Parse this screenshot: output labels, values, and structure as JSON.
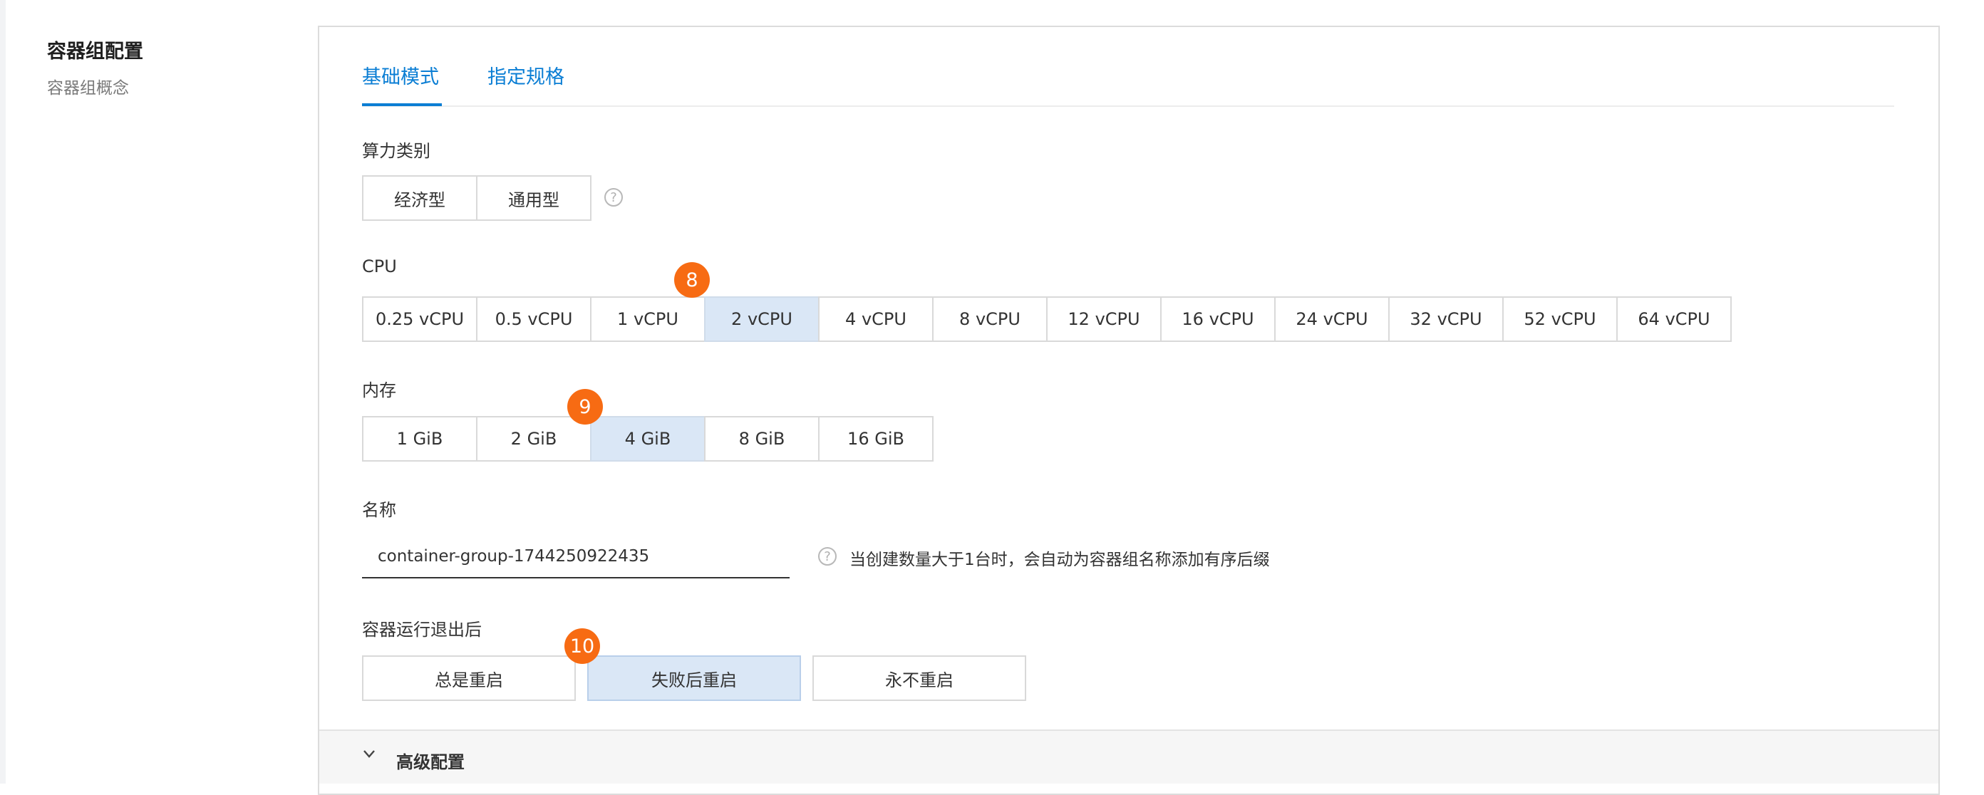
{
  "section": {
    "title": "容器组配置",
    "subtitle": "容器组概念"
  },
  "tabs": [
    {
      "label": "基础模式",
      "active": true
    },
    {
      "label": "指定规格",
      "active": false
    }
  ],
  "compute_type": {
    "label": "算力类别",
    "options": [
      "经济型",
      "通用型"
    ],
    "help_icon": "question-circle-icon"
  },
  "cpu": {
    "label": "CPU",
    "options": [
      "0.25 vCPU",
      "0.5 vCPU",
      "1 vCPU",
      "2 vCPU",
      "4 vCPU",
      "8 vCPU",
      "12 vCPU",
      "16 vCPU",
      "24 vCPU",
      "32 vCPU",
      "52 vCPU",
      "64 vCPU"
    ],
    "selected": "2 vCPU",
    "badge": "8"
  },
  "memory": {
    "label": "内存",
    "options": [
      "1 GiB",
      "2 GiB",
      "4 GiB",
      "8 GiB",
      "16 GiB"
    ],
    "selected": "4 GiB",
    "badge": "9"
  },
  "name": {
    "label": "名称",
    "value": "container-group-1744250922435",
    "hint": "当创建数量大于1台时，会自动为容器组名称添加有序后缀",
    "help_icon": "question-circle-icon"
  },
  "restart_policy": {
    "label": "容器运行退出后",
    "options": [
      "总是重启",
      "失败后重启",
      "永不重启"
    ],
    "selected": "失败后重启",
    "badge": "10"
  },
  "advanced": {
    "label": "高级配置",
    "icon": "chevron-down-icon"
  },
  "colors": {
    "accent": "#0b7ed4",
    "badge": "#f76b13",
    "selected_bg": "#dae7f6"
  }
}
